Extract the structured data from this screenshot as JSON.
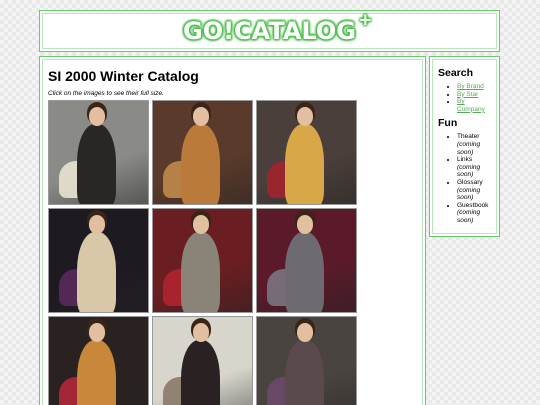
{
  "header": {
    "logo_text": "GO!CATALOG",
    "logo_superscript": "+"
  },
  "main": {
    "title": "SI 2000 Winter Catalog",
    "instructions": "Click on the images to see their full size.",
    "photos": [
      {
        "bg": "#8a8a86",
        "accent": "#e8e2d0",
        "coat": "#2a2624"
      },
      {
        "bg": "#5a3a2a",
        "accent": "#c08a4a",
        "coat": "#b97a3c"
      },
      {
        "bg": "#4a3f3a",
        "accent": "#a0242e",
        "coat": "#d8a848"
      },
      {
        "bg": "#1e1a22",
        "accent": "#5a2a5a",
        "coat": "#d8c8a8"
      },
      {
        "bg": "#6a1e22",
        "accent": "#b02430",
        "coat": "#8a8478"
      },
      {
        "bg": "#5a1a2a",
        "accent": "#7a7680",
        "coat": "#6e6a72"
      },
      {
        "bg": "#2a2220",
        "accent": "#b02838",
        "coat": "#c8883a"
      },
      {
        "bg": "#d8d6cc",
        "accent": "#8a7a6a",
        "coat": "#2a2222"
      },
      {
        "bg": "#4a4440",
        "accent": "#6a4a6a",
        "coat": "#5a4a4e"
      }
    ]
  },
  "sidebar": {
    "search_heading": "Search",
    "search_links": [
      "By Brand",
      "By Star",
      "By Company"
    ],
    "fun_heading": "Fun",
    "fun_items": [
      {
        "label": "Theater",
        "note": "(coming soon)"
      },
      {
        "label": "Links",
        "note": "(coming soon)"
      },
      {
        "label": "Glossary",
        "note": "(coming soon)"
      },
      {
        "label": "Guestbook",
        "note": "(coming soon)"
      }
    ]
  },
  "colors": {
    "panel_border": "#66cc66",
    "link": "#55aa55"
  }
}
